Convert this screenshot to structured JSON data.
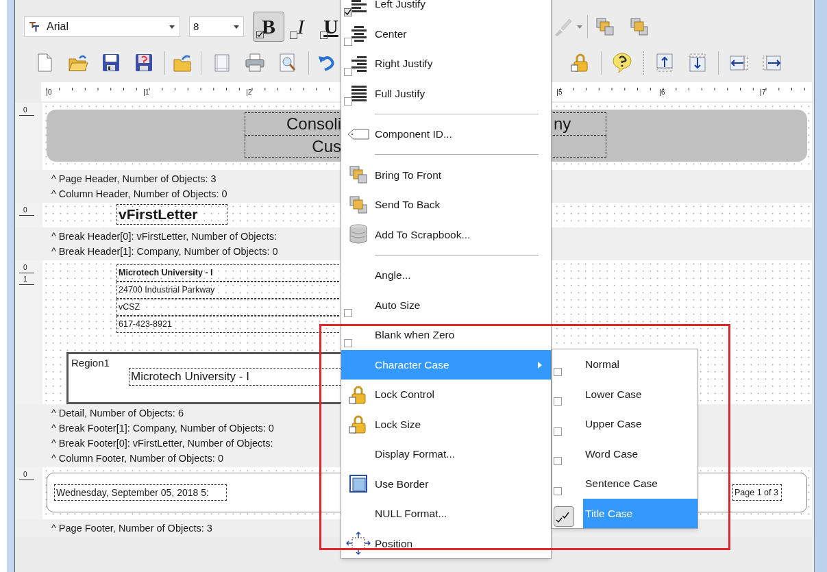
{
  "toolbar": {
    "font": "Arial",
    "font_size": "8",
    "style_buttons": [
      {
        "label": "B",
        "kind": "bold",
        "checked": true
      },
      {
        "label": "I",
        "kind": "italic",
        "checked": false
      },
      {
        "label": "U",
        "kind": "underline",
        "checked": false
      }
    ]
  },
  "ruler": [
    "0",
    "1",
    "2",
    "5",
    "6",
    "7"
  ],
  "report": {
    "page_header": {
      "mark": "0",
      "title_parts": [
        "Consoli",
        "ny"
      ],
      "subtitle": "Cus"
    },
    "labels_top": [
      "^ Page Header, Number of Objects: 3",
      "^ Column Header, Number of Objects: 0"
    ],
    "break_header": {
      "mark": "0",
      "field": "vFirstLetter"
    },
    "labels_break": [
      "^ Break Header[0]: vFirstLetter, Number of Objects:",
      "^ Break Header[1]: Company, Number of Objects: 0"
    ],
    "detail": {
      "marks": [
        "0",
        "1"
      ],
      "lines": [
        "Microtech University - I",
        "24700 Industrial Parkway",
        "vCSZ",
        "617-423-8921"
      ],
      "region": {
        "label": "Region1",
        "field": "Microtech University - I"
      }
    },
    "labels_detail": [
      "^ Detail, Number of Objects: 6",
      "^ Break Footer[1]: Company, Number of Objects: 0",
      "^ Break Footer[0]: vFirstLetter, Number of Objects:",
      "^ Column Footer, Number of Objects: 0"
    ],
    "page_footer": {
      "mark": "0",
      "date": "Wednesday, September 05, 2018 5:",
      "page": "Page 1 of 3"
    },
    "labels_bottom": [
      "^ Page Footer, Number of Objects: 3"
    ]
  },
  "menu": {
    "items": [
      {
        "label": "Left Justify",
        "kind": "align",
        "checked": true,
        "highlighted": false
      },
      {
        "label": "Center",
        "kind": "align",
        "checked": false,
        "highlighted": false
      },
      {
        "label": "Right Justify",
        "kind": "align",
        "checked": false,
        "highlighted": false
      },
      {
        "label": "Full Justify",
        "kind": "align",
        "checked": false,
        "highlighted": false
      },
      {
        "kind": "separator"
      },
      {
        "label": "Component ID...",
        "kind": "tag",
        "highlighted": false
      },
      {
        "kind": "separator"
      },
      {
        "label": "Bring To Front",
        "kind": "front",
        "highlighted": false
      },
      {
        "label": "Send To Back",
        "kind": "back",
        "highlighted": false
      },
      {
        "label": "Add To Scrapbook...",
        "kind": "scrapbook",
        "highlighted": false
      },
      {
        "kind": "separator"
      },
      {
        "label": "Angle...",
        "kind": "plain",
        "highlighted": false
      },
      {
        "label": "Auto Size",
        "kind": "check",
        "checked": false,
        "highlighted": false
      },
      {
        "label": "Blank when Zero",
        "kind": "check",
        "checked": false,
        "highlighted": false
      },
      {
        "label": "Character Case",
        "kind": "submenu",
        "highlighted": true
      },
      {
        "label": "Lock Control",
        "kind": "lock",
        "highlighted": false
      },
      {
        "label": "Lock Size",
        "kind": "lock",
        "highlighted": false
      },
      {
        "label": "Display Format...",
        "kind": "plain",
        "highlighted": false
      },
      {
        "label": "Use Border",
        "kind": "border",
        "highlighted": false
      },
      {
        "label": "NULL Format...",
        "kind": "plain",
        "highlighted": false
      },
      {
        "label": "Position",
        "kind": "position",
        "highlighted": false
      }
    ]
  },
  "submenu": {
    "items": [
      {
        "label": "Normal",
        "checked": false,
        "highlighted": false
      },
      {
        "label": "Lower Case",
        "checked": false,
        "highlighted": false
      },
      {
        "label": "Upper Case",
        "checked": false,
        "highlighted": false
      },
      {
        "label": "Word Case",
        "checked": false,
        "highlighted": false
      },
      {
        "label": "Sentence Case",
        "checked": false,
        "highlighted": false
      },
      {
        "label": "Title Case",
        "checked": true,
        "highlighted": true
      }
    ]
  }
}
